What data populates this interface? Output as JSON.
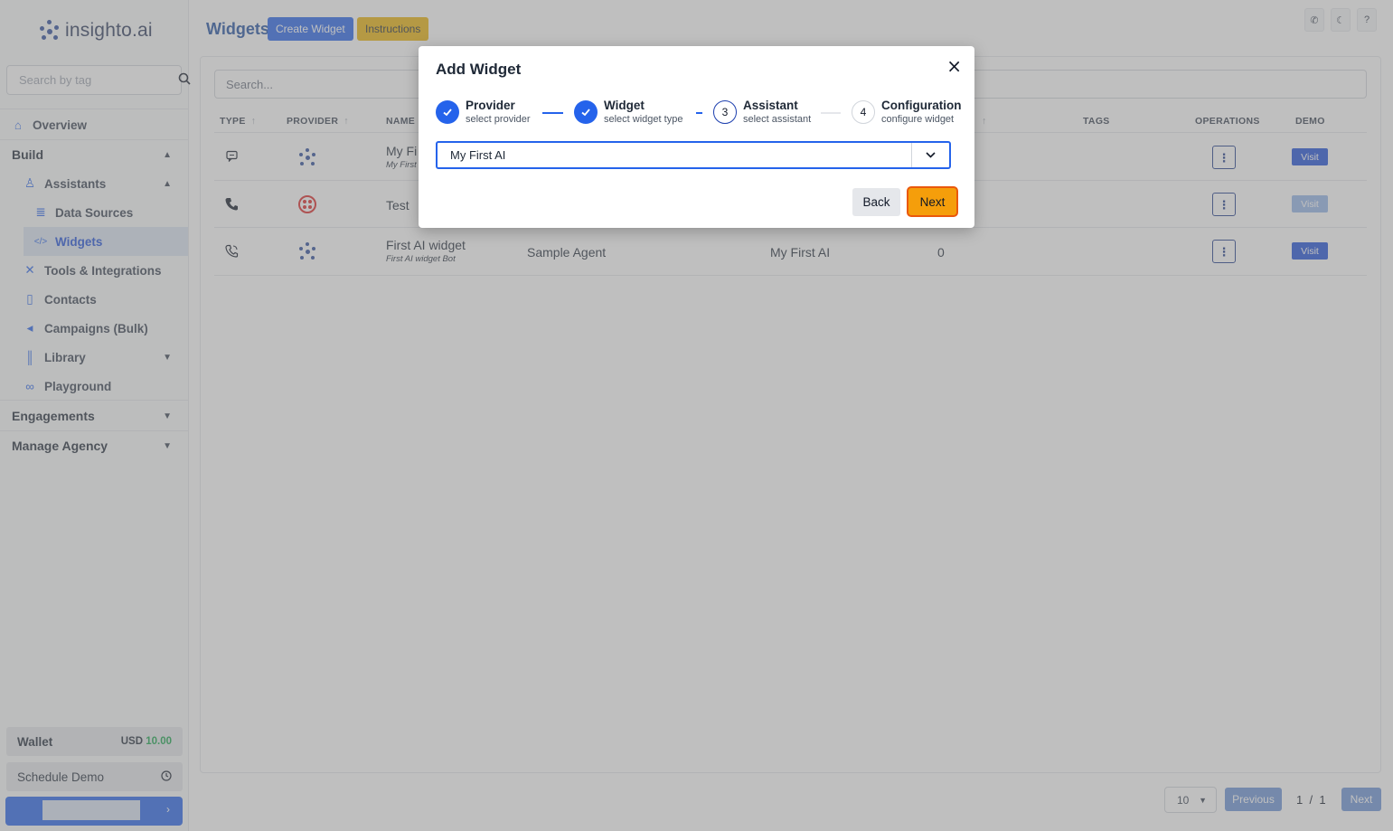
{
  "brand": {
    "name": "insighto.ai"
  },
  "sidebar": {
    "search_placeholder": "Search by tag",
    "items": [
      {
        "label": "Overview",
        "icon": "home-icon"
      },
      {
        "label": "Build",
        "icon": ""
      },
      {
        "label": "Assistants",
        "icon": "user-icon"
      },
      {
        "label": "Data Sources",
        "icon": "database-icon"
      },
      {
        "label": "Widgets",
        "icon": "code-icon"
      },
      {
        "label": "Tools & Integrations",
        "icon": "tools-icon"
      },
      {
        "label": "Contacts",
        "icon": "contact-icon"
      },
      {
        "label": "Campaigns (Bulk)",
        "icon": "megaphone-icon"
      },
      {
        "label": "Library",
        "icon": "library-icon"
      },
      {
        "label": "Playground",
        "icon": "gamepad-icon"
      },
      {
        "label": "Engagements",
        "icon": ""
      },
      {
        "label": "Manage Agency",
        "icon": ""
      }
    ],
    "wallet": {
      "label": "Wallet",
      "currency": "USD",
      "amount": "10.00"
    },
    "schedule_demo": "Schedule Demo"
  },
  "header": {
    "title": "Widgets",
    "create_button": "Create Widget",
    "instructions_button": "Instructions"
  },
  "main": {
    "search_placeholder": "Search...",
    "columns": [
      "TYPE",
      "PROVIDER",
      "NAME",
      "TAGS",
      "OPERATIONS",
      "DEMO"
    ],
    "rows": [
      {
        "name": "My Fi",
        "subtitle": "My First",
        "assistant": "",
        "model": "",
        "count": "",
        "visit": "Visit"
      },
      {
        "name": "Test",
        "subtitle": "",
        "assistant": "",
        "model": "",
        "count": "",
        "visit": "Visit"
      },
      {
        "name": "First AI widget",
        "subtitle": "First AI widget Bot",
        "assistant": "Sample Agent",
        "model": "My First AI",
        "count": "0",
        "visit": "Visit"
      }
    ]
  },
  "pagination": {
    "page_size": "10",
    "previous": "Previous",
    "next": "Next",
    "page": "1",
    "sep": "/",
    "total": "1"
  },
  "modal": {
    "title": "Add Widget",
    "steps": [
      {
        "label": "Provider",
        "sub": "select provider",
        "state": "done"
      },
      {
        "label": "Widget",
        "sub": "select widget type",
        "state": "done"
      },
      {
        "number": "3",
        "label": "Assistant",
        "sub": "select assistant",
        "state": "current"
      },
      {
        "number": "4",
        "label": "Configuration",
        "sub": "configure widget",
        "state": "todo"
      }
    ],
    "selected_assistant": "My First AI",
    "back_button": "Back",
    "next_button": "Next"
  },
  "colors": {
    "accent": "#2563eb",
    "next_button": "#f59e0b",
    "instructions": "#eab308"
  }
}
